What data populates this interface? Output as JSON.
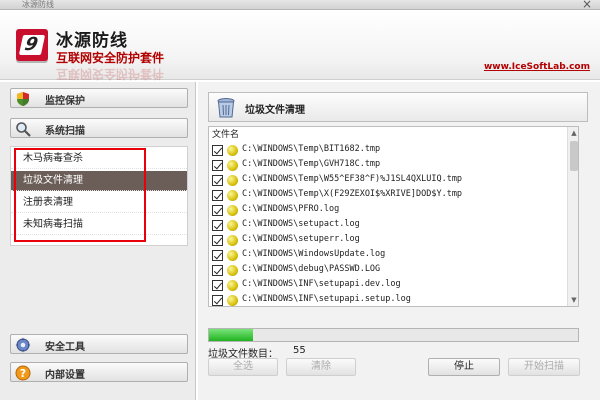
{
  "window": {
    "caption": "冰源防线",
    "close_glyph": "×"
  },
  "header": {
    "logo_glyph": "9",
    "title": "冰源防线",
    "subtitle": "互联网安全防护套件",
    "site": "www.IceSoftLab.com"
  },
  "sidebar": {
    "nav": [
      {
        "label": "监控保护",
        "icon": "shield-icon"
      },
      {
        "label": "系统扫描",
        "icon": "magnifier-icon"
      },
      {
        "label": "安全工具",
        "icon": "gear-icon"
      },
      {
        "label": "内部设置",
        "icon": "question-icon"
      }
    ],
    "submenu": [
      {
        "label": "木马病毒查杀"
      },
      {
        "label": "垃圾文件清理"
      },
      {
        "label": "注册表清理"
      },
      {
        "label": "未知病毒扫描"
      }
    ],
    "selected_index": 1,
    "highlight_color": "#e8000b"
  },
  "main": {
    "panel_title": "垃圾文件清理",
    "column_header": "文件名",
    "files": [
      "C:\\WINDOWS\\Temp\\BIT1682.tmp",
      "C:\\WINDOWS\\Temp\\GVH718C.tmp",
      "C:\\WINDOWS\\Temp\\W55^EF38^F)%J1SL4QXLUIQ.tmp",
      "C:\\WINDOWS\\Temp\\X(F29ZEXOI$%XRIVE]DOD$Y.tmp",
      "C:\\WINDOWS\\PFRO.log",
      "C:\\WINDOWS\\setupact.log",
      "C:\\WINDOWS\\setuperr.log",
      "C:\\WINDOWS\\WindowsUpdate.log",
      "C:\\WINDOWS\\debug\\PASSWD.LOG",
      "C:\\WINDOWS\\INF\\setupapi.dev.log",
      "C:\\WINDOWS\\INF\\setupapi.setup.log"
    ],
    "progress_fraction": 0.12,
    "count_label": "垃圾文件数目：",
    "count_value": "55",
    "buttons": {
      "select_all": "全选",
      "clear": "清除",
      "stop": "停止",
      "start_scan": "开始扫描"
    }
  }
}
